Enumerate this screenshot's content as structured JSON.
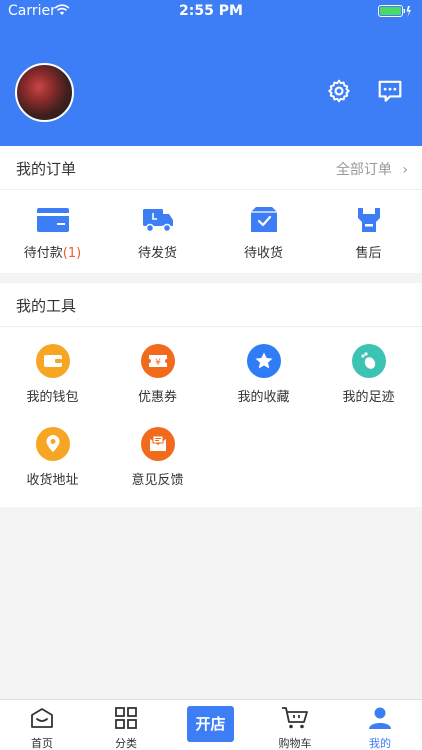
{
  "status_bar": {
    "carrier": "Carrier",
    "time": "2:55 PM"
  },
  "header": {
    "avatar_icon": "avatar",
    "settings_icon": "gear-icon",
    "message_icon": "message-icon"
  },
  "orders": {
    "title": "我的订单",
    "all_label": "全部订单",
    "items": [
      {
        "label": "待付款",
        "count": "(1)",
        "icon": "wallet-card-icon"
      },
      {
        "label": "待发货",
        "icon": "truck-icon"
      },
      {
        "label": "待收货",
        "icon": "package-check-icon"
      },
      {
        "label": "售后",
        "icon": "wrench-icon"
      }
    ]
  },
  "tools": {
    "title": "我的工具",
    "items": [
      {
        "label": "我的钱包",
        "icon": "wallet-icon",
        "color": "#f6a623"
      },
      {
        "label": "优惠券",
        "icon": "coupon-icon",
        "color": "#f26b1d"
      },
      {
        "label": "我的收藏",
        "icon": "star-icon",
        "color": "#2f7cf6"
      },
      {
        "label": "我的足迹",
        "icon": "footprint-icon",
        "color": "#3cc3b4"
      },
      {
        "label": "收货地址",
        "icon": "location-icon",
        "color": "#f6a623"
      },
      {
        "label": "意见反馈",
        "icon": "feedback-icon",
        "color": "#f26b1d"
      }
    ]
  },
  "tabbar": {
    "items": [
      {
        "label": "首页",
        "icon": "home-icon"
      },
      {
        "label": "分类",
        "icon": "grid-icon"
      },
      {
        "label": "开店",
        "icon": "open-store-button"
      },
      {
        "label": "购物车",
        "icon": "cart-icon"
      },
      {
        "label": "我的",
        "icon": "user-icon",
        "active": true
      }
    ],
    "accent": "#3d7ef6"
  }
}
